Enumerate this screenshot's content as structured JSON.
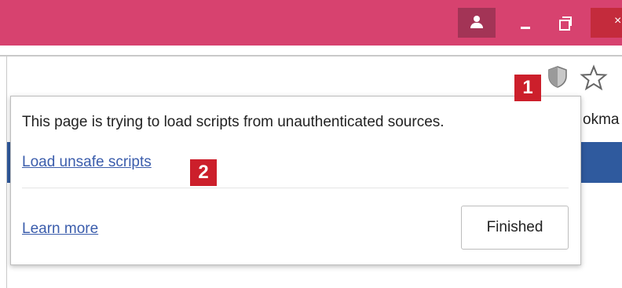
{
  "window": {
    "profile_icon": "person-icon",
    "minimize_icon": "minimize-icon",
    "restore_icon": "restore-icon",
    "close_icon": "close-icon",
    "titlebar_color": "#d7426f"
  },
  "toolbar": {
    "shield_icon": "shield-icon",
    "star_icon": "star-icon",
    "bookmark_partial": "okma"
  },
  "popup": {
    "message": "This page is trying to load scripts from unauthenticated sources.",
    "load_link": "Load unsafe scripts",
    "learn_more": "Learn more",
    "finished_label": "Finished"
  },
  "badges": {
    "one": "1",
    "two": "2"
  },
  "colors": {
    "link": "#3b5dac",
    "badge": "#cc1f2b"
  }
}
